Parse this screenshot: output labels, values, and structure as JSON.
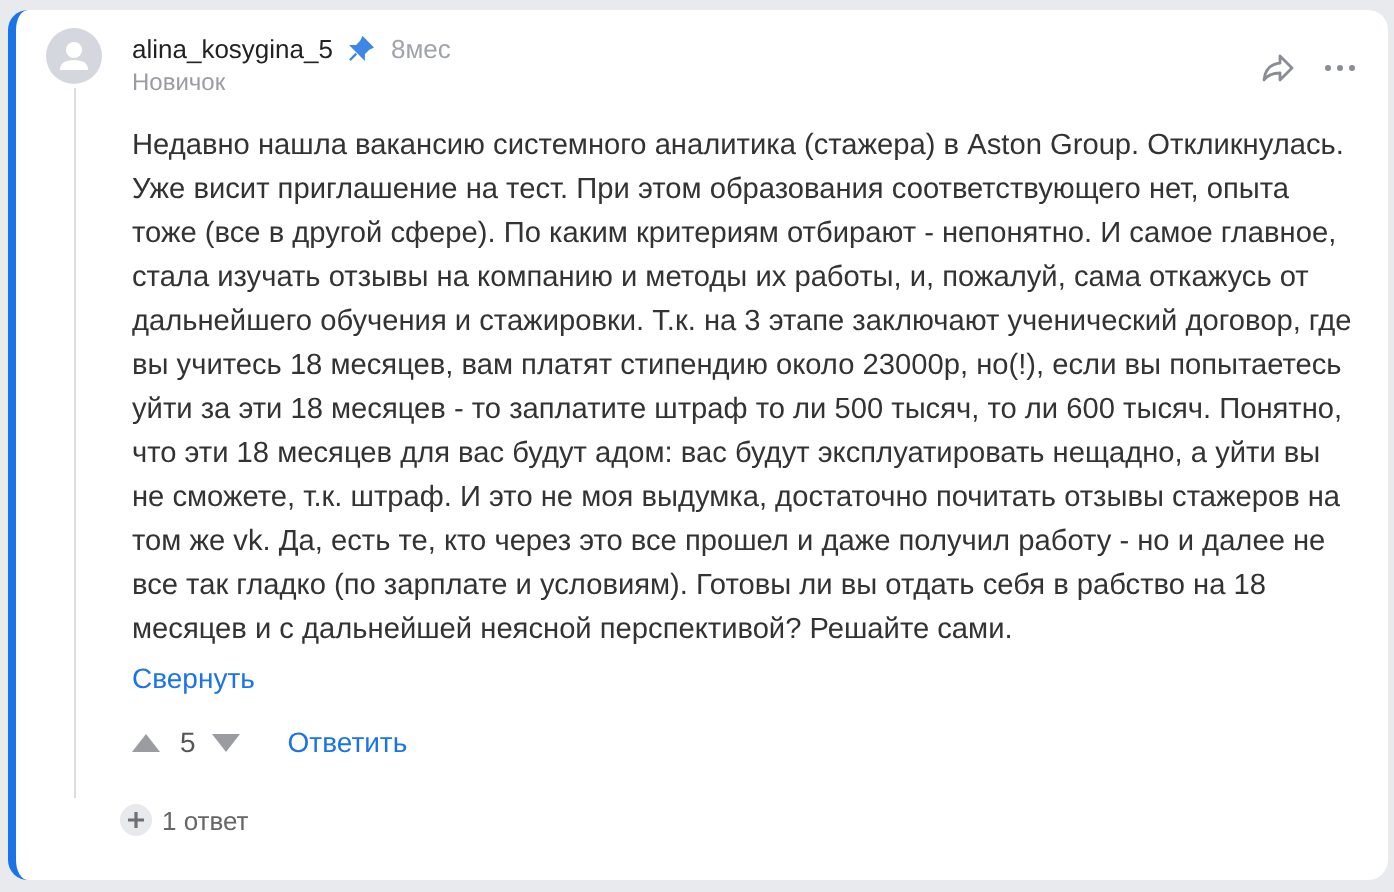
{
  "comment": {
    "author": "alina_kosygina_5",
    "pinned": true,
    "time": "8мес",
    "rank": "Новичок",
    "text": "Недавно нашла вакансию системного аналитика (стажера) в Aston Group. Откликнулась. Уже висит приглашение на тест. При этом образования соответствующего нет, опыта тоже (все в другой сфере). По каким критериям отбирают - непонятно. И самое главное, стала изучать отзывы на компанию и методы их работы, и, пожалуй, сама откажусь от дальнейшего обучения и стажировки. Т.к. на 3 этапе заключают ученический договор, где вы учитесь 18 месяцев, вам платят стипендию около 23000р, но(!), если вы попытаетесь уйти за эти 18 месяцев - то заплатите штраф то ли 500 тысяч, то ли 600 тысяч. Понятно, что эти 18 месяцев для вас будут адом: вас будут эксплуатировать нещадно, а уйти вы не сможете, т.к. штраф. И это не моя выдумка, достаточно почитать отзывы стажеров на том же vk. Да, есть те, кто через это все прошел и даже получил работу - но и далее не все так гладко (по зарплате и условиям). Готовы ли вы отдать себя в рабство на 18 месяцев и с дальнейшей неясной перспективой? Решайте сами.",
    "collapse": "Свернуть",
    "votes": "5",
    "reply": "Ответить",
    "replies": "1 ответ"
  }
}
